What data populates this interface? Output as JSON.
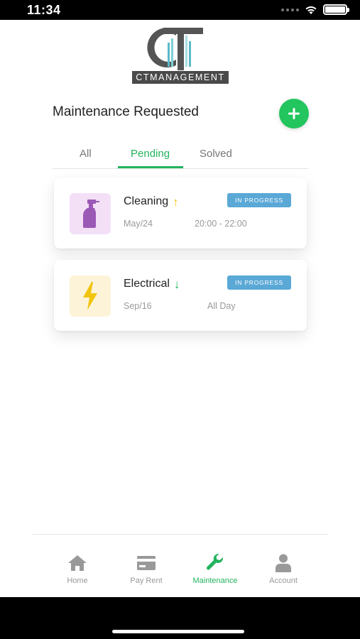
{
  "status_bar": {
    "time": "11:34"
  },
  "logo": {
    "plate_text": "CTMANAGEMENT"
  },
  "header": {
    "title": "Maintenance Requested"
  },
  "tabs": [
    {
      "label": "All",
      "active": false
    },
    {
      "label": "Pending",
      "active": true
    },
    {
      "label": "Solved",
      "active": false
    }
  ],
  "requests": [
    {
      "title": "Cleaning",
      "priority": "up",
      "priority_glyph": "↑",
      "date": "May/24",
      "time": "20:00 - 22:00",
      "status": "IN PROGRESS",
      "icon": "spray-bottle-icon",
      "icon_bg": "#f3e0f7",
      "icon_color": "#9b59b6",
      "arrow_color": "#f1c40f"
    },
    {
      "title": "Electrical",
      "priority": "down",
      "priority_glyph": "↓",
      "date": "Sep/16",
      "time": "All Day",
      "status": "IN PROGRESS",
      "icon": "lightning-icon",
      "icon_bg": "#fdf3d8",
      "icon_color": "#f1c40f",
      "arrow_color": "#22b35e"
    }
  ],
  "bottom_nav": [
    {
      "label": "Home",
      "icon": "home-icon",
      "active": false
    },
    {
      "label": "Pay Rent",
      "icon": "card-icon",
      "active": false
    },
    {
      "label": "Maintenance",
      "icon": "wrench-icon",
      "active": true
    },
    {
      "label": "Account",
      "icon": "person-icon",
      "active": false
    }
  ],
  "colors": {
    "accent": "#22b35e",
    "add_button": "#22c55e",
    "badge": "#5aa8d6"
  }
}
